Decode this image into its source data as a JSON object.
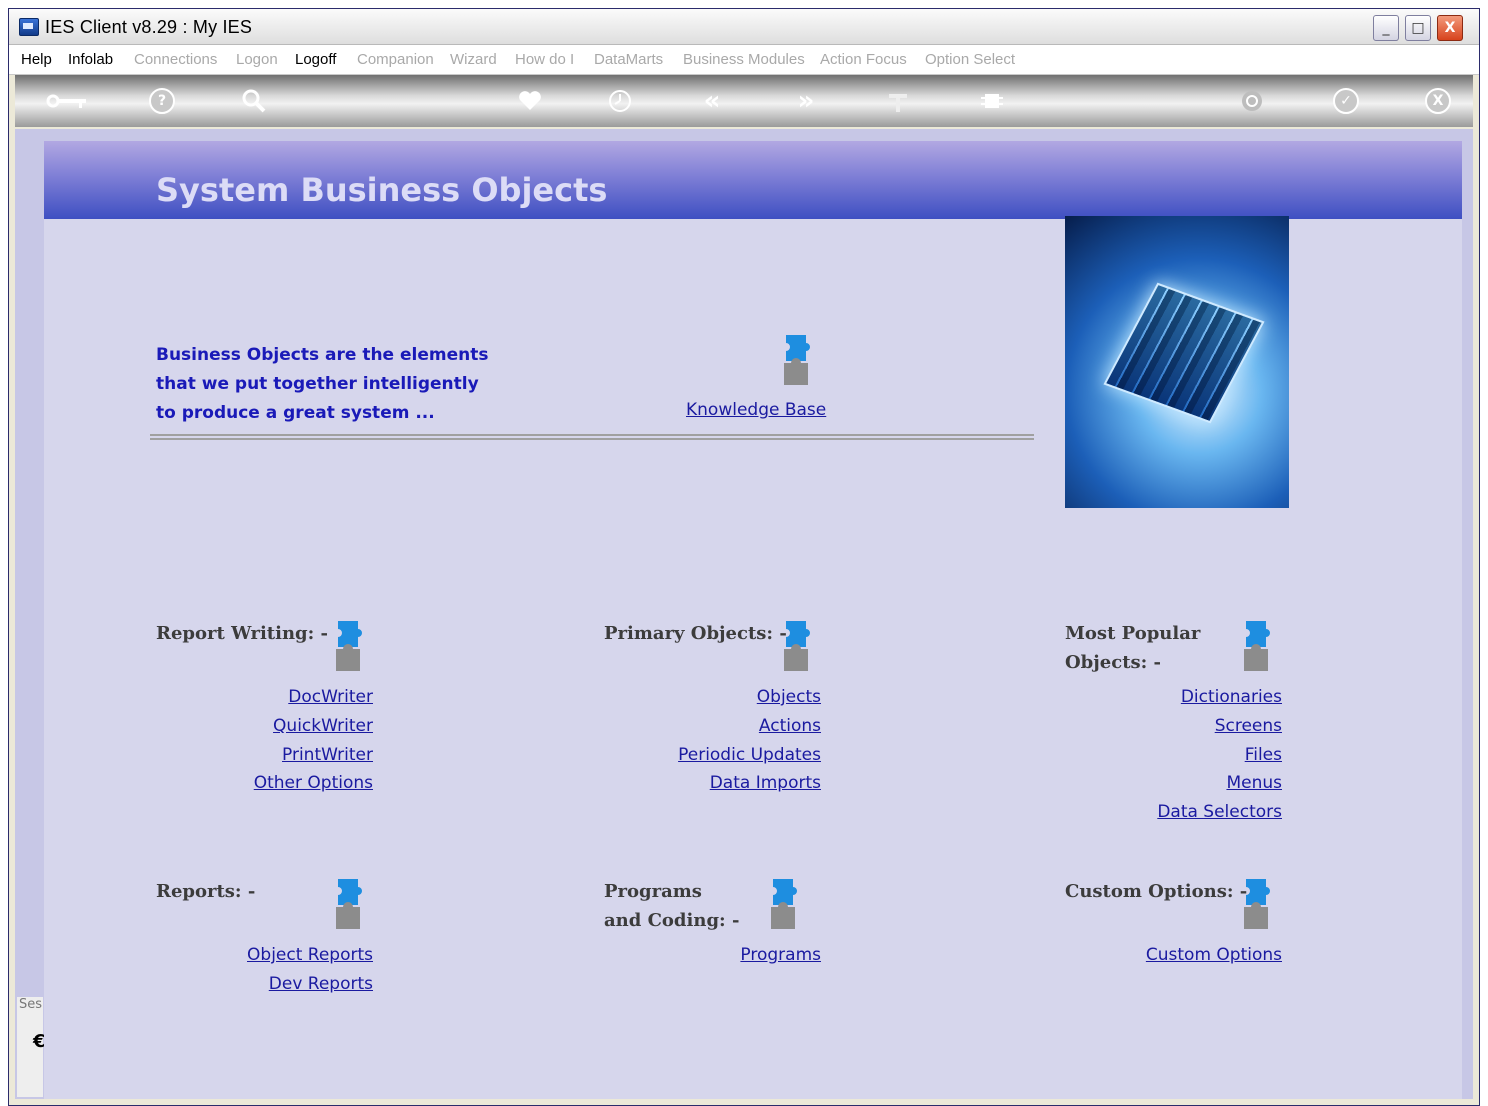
{
  "window": {
    "title": "IES Client v8.29 : My IES",
    "controls": {
      "minimize": "_",
      "maximize": "□",
      "close": "X"
    }
  },
  "menu": [
    {
      "label": "Help",
      "enabled": true
    },
    {
      "label": "Infolab",
      "enabled": true
    },
    {
      "label": "Connections",
      "enabled": false
    },
    {
      "label": "Logon",
      "enabled": false
    },
    {
      "label": "Logoff",
      "enabled": true
    },
    {
      "label": "Companion",
      "enabled": false
    },
    {
      "label": "Wizard",
      "enabled": false
    },
    {
      "label": "How do I",
      "enabled": false
    },
    {
      "label": "DataMarts",
      "enabled": false
    },
    {
      "label": "Business Modules",
      "enabled": false
    },
    {
      "label": "Action Focus",
      "enabled": false
    },
    {
      "label": "Option Select",
      "enabled": false
    }
  ],
  "toolbar": {
    "icons": [
      "key-icon",
      "help-icon",
      "search-icon",
      "heart-icon",
      "clock-icon",
      "back-icon",
      "forward-icon",
      "tool-icon",
      "chip-icon",
      "recycle-icon",
      "check-icon",
      "close-icon"
    ],
    "glyphs": {
      "help": "?",
      "check": "✓",
      "close": "X",
      "back": "«",
      "forward": "»"
    }
  },
  "page": {
    "title": "System Business Objects",
    "intro": [
      "Business Objects are the elements",
      "that we put together intelligently",
      "to produce a great system ..."
    ],
    "knowledge_base": "Knowledge Base",
    "side_label": "Ses",
    "side_glyph": "€"
  },
  "sections": {
    "report_writing": {
      "heading": "Report Writing: -",
      "links": [
        "DocWriter",
        "QuickWriter",
        "PrintWriter",
        "Other Options"
      ]
    },
    "primary_objects": {
      "heading": "Primary Objects: -",
      "links": [
        "Objects",
        "Actions",
        "Periodic Updates",
        "Data Imports"
      ]
    },
    "most_popular": {
      "heading": [
        "Most Popular",
        "Objects: -"
      ],
      "links": [
        "Dictionaries",
        "Screens",
        "Files",
        "Menus",
        "Data Selectors"
      ]
    },
    "reports": {
      "heading": "Reports: -",
      "links": [
        "Object Reports",
        "Dev Reports"
      ]
    },
    "programs": {
      "heading": [
        "Programs",
        "and Coding: -"
      ],
      "links": [
        "Programs"
      ]
    },
    "custom": {
      "heading": "Custom Options: -",
      "links": [
        "Custom Options"
      ]
    }
  },
  "colors": {
    "banner_top": "#b2a8e2",
    "banner_bottom": "#3e4fc2",
    "panel_bg": "#d6d6ec",
    "intro_text": "#1a1ab8",
    "link": "#1a1aa0",
    "puzzle_blue": "#1e8ee0",
    "puzzle_gray": "#8c8c8c"
  }
}
